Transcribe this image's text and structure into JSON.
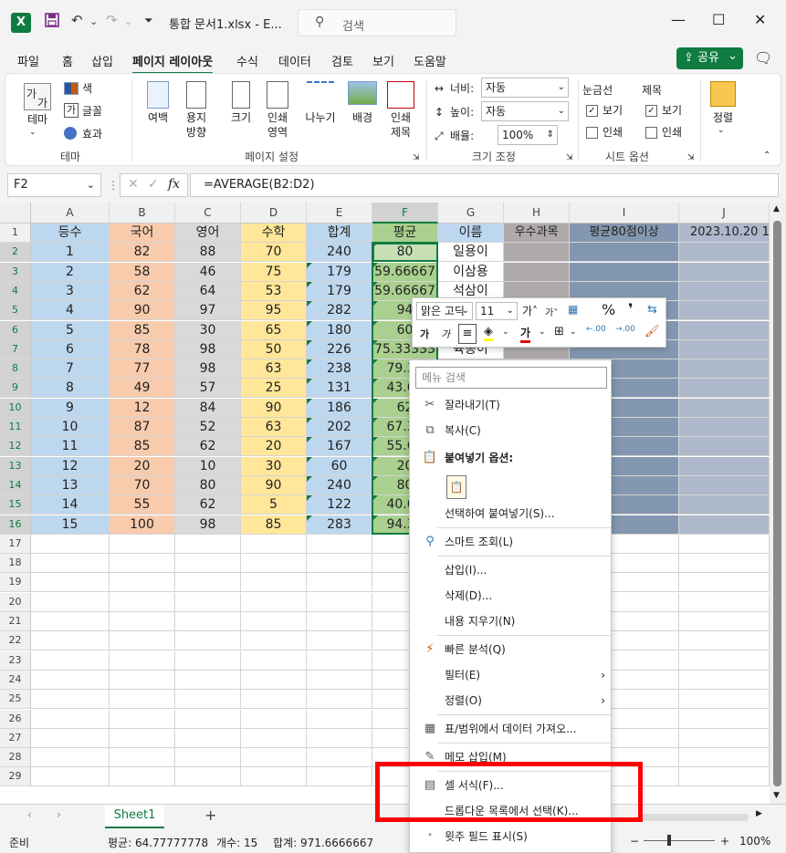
{
  "titlebar": {
    "logo": "X",
    "save_icon": "save-icon",
    "undo_icon": "undo-icon",
    "redo_icon": "redo-icon",
    "customize_icon": "customize-icon",
    "file_title": "통합 문서1.xlsx  -  E...",
    "search_placeholder": "검색",
    "minimize": "—",
    "maximize": "☐",
    "close": "✕"
  },
  "menu": {
    "tabs": [
      "파일",
      "홈",
      "삽입",
      "페이지 레이아웃",
      "수식",
      "데이터",
      "검토",
      "보기",
      "도움말"
    ],
    "active_tab": "페이지 레이아웃",
    "share": "공유",
    "share_arrow": "⌄"
  },
  "ribbon": {
    "theme": {
      "themes": "테마",
      "colors": "색",
      "fonts": "글꼴",
      "effects": "효과",
      "group": "테마"
    },
    "page_setup": {
      "margins": "여백",
      "orientation": "용지\n방향",
      "size": "크기",
      "print_area": "인쇄\n영역",
      "breaks": "나누기",
      "background": "배경",
      "print_titles": "인쇄\n제목",
      "group": "페이지 설정"
    },
    "scale": {
      "width_label": "너비:",
      "width_value": "자동",
      "height_label": "높이:",
      "height_value": "자동",
      "scale_label": "배율:",
      "scale_value": "100%",
      "group": "크기 조정"
    },
    "sheet_options": {
      "gridlines": "눈금선",
      "headings": "제목",
      "view": "보기",
      "print": "인쇄",
      "group": "시트 옵션"
    },
    "arrange": {
      "label": "정렬"
    }
  },
  "formula": {
    "namebox": "F2",
    "formula": "=AVERAGE(B2:D2)",
    "fx": "fx"
  },
  "columns": [
    "A",
    "B",
    "C",
    "D",
    "E",
    "F",
    "G",
    "H",
    "I",
    "J"
  ],
  "headers": [
    "등수",
    "국어",
    "영어",
    "수학",
    "합계",
    "평균",
    "이름",
    "우수과목",
    "평균80점이상",
    "2023.10.20  1"
  ],
  "rows": [
    [
      "1",
      "82",
      "88",
      "70",
      "240",
      "80",
      "일용이"
    ],
    [
      "2",
      "58",
      "46",
      "75",
      "179",
      "59.66667",
      "이삼용"
    ],
    [
      "3",
      "62",
      "64",
      "53",
      "179",
      "59.66667",
      "석삼이"
    ],
    [
      "4",
      "90",
      "97",
      "95",
      "282",
      "94",
      ""
    ],
    [
      "5",
      "85",
      "30",
      "65",
      "180",
      "60",
      ""
    ],
    [
      "6",
      "78",
      "98",
      "50",
      "226",
      "75.33333",
      "육동이"
    ],
    [
      "7",
      "77",
      "98",
      "63",
      "238",
      "79.33",
      ""
    ],
    [
      "8",
      "49",
      "57",
      "25",
      "131",
      "43.66",
      ""
    ],
    [
      "9",
      "12",
      "84",
      "90",
      "186",
      "62",
      ""
    ],
    [
      "10",
      "87",
      "52",
      "63",
      "202",
      "67.33",
      ""
    ],
    [
      "11",
      "85",
      "62",
      "20",
      "167",
      "55.66",
      ""
    ],
    [
      "12",
      "20",
      "10",
      "30",
      "60",
      "20",
      ""
    ],
    [
      "13",
      "70",
      "80",
      "90",
      "240",
      "80",
      ""
    ],
    [
      "14",
      "55",
      "62",
      "5",
      "122",
      "40.66",
      ""
    ],
    [
      "15",
      "100",
      "98",
      "85",
      "283",
      "94.33",
      ""
    ]
  ],
  "row_numbers": [
    "1",
    "2",
    "3",
    "4",
    "5",
    "6",
    "7",
    "8",
    "9",
    "10",
    "11",
    "12",
    "13",
    "14",
    "15",
    "16",
    "17",
    "18",
    "19",
    "20",
    "21",
    "22",
    "23",
    "24",
    "25",
    "26",
    "27",
    "28",
    "29"
  ],
  "colors": {
    "header_blue": "#bdd7ee",
    "orange": "#f8cbad",
    "gray": "#d9d9d9",
    "yellow": "#ffe699",
    "avg_green": "#a9d08e",
    "h_col": "#aeaaaa",
    "i_col": "#8497b0",
    "j_col": "#adb9ca",
    "excel_green": "#107c41",
    "highlight_red": "#ff0000"
  },
  "mini_toolbar": {
    "font": "맑은 고딕",
    "size": "11",
    "grow": "가˄",
    "shrink": "가˅",
    "percent": "%",
    "comma": "❜",
    "bold": "가",
    "italic": "가",
    "font_color": "가",
    "dec_dec": ".00",
    "inc_dec": ".00"
  },
  "context_menu": {
    "search": "메뉴 검색",
    "cut": "잘라내기(T)",
    "copy": "복사(C)",
    "paste_options": "붙여넣기 옵션:",
    "paste_special": "선택하여 붙여넣기(S)...",
    "smart_lookup": "스마트 조회(L)",
    "insert": "삽입(I)...",
    "delete": "삭제(D)...",
    "clear_contents": "내용 지우기(N)",
    "quick_analysis": "빠른 분석(Q)",
    "filter": "필터(E)",
    "sort": "정렬(O)",
    "get_data": "표/범위에서 데이터 가져오...",
    "insert_comment": "메모 삽입(M)",
    "format_cells": "셀 서식(F)...",
    "pick_list": "드롭다운 목록에서 선택(K)...",
    "phonetic": "윗주 필드 표시(S)"
  },
  "sheet": {
    "tab": "Sheet1",
    "add": "+"
  },
  "status": {
    "ready": "준비",
    "average": "평균: 64.77777778",
    "count": "개수: 15",
    "sum": "합계: 971.6666667",
    "zoom": "100%"
  }
}
